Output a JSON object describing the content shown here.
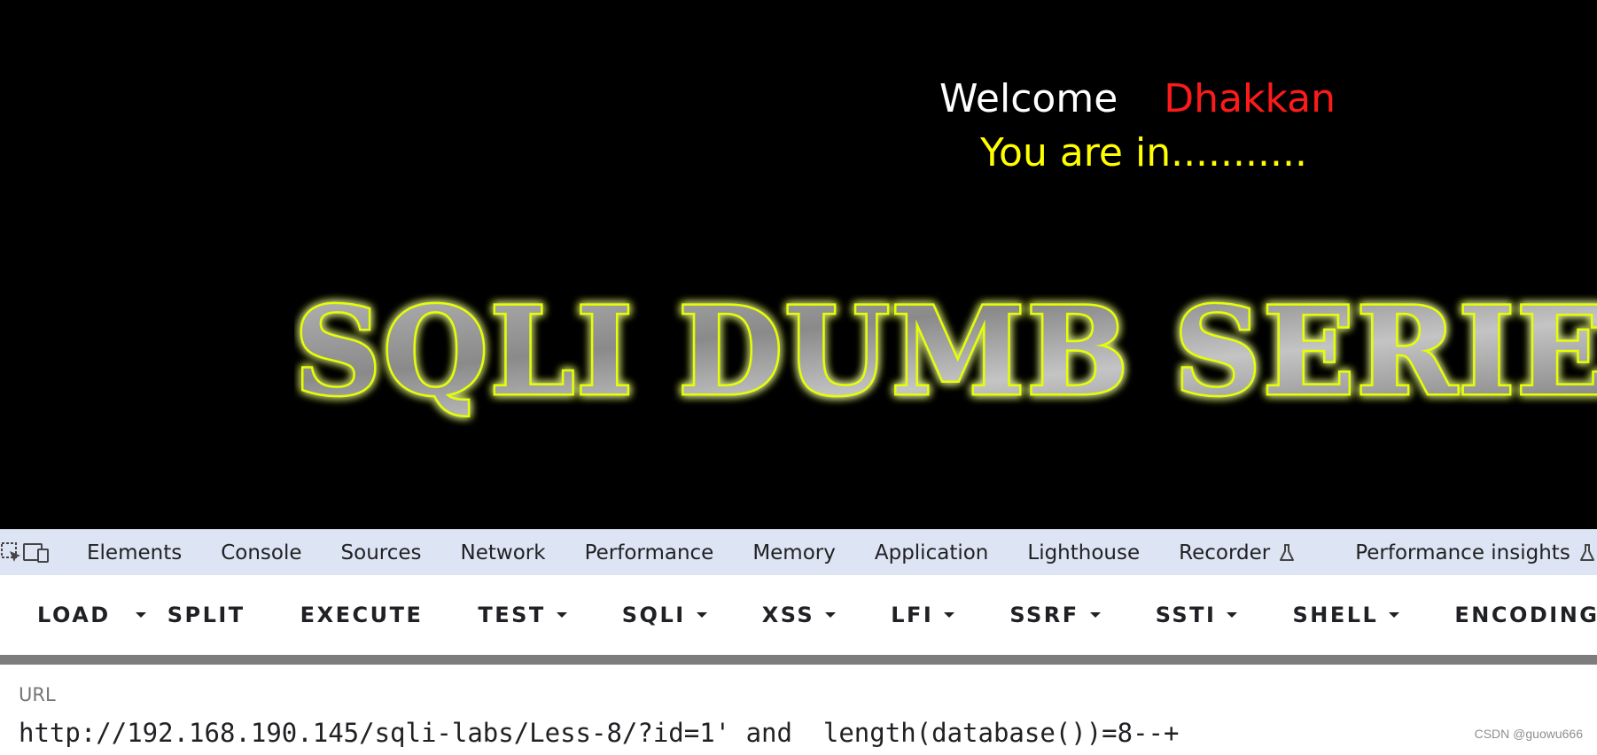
{
  "web": {
    "welcome_word": "Welcome",
    "welcome_name": "Dhakkan",
    "status": "You are in...........",
    "banner_text": "SQLI DUMB SERIES"
  },
  "devtools": {
    "tabs": [
      {
        "label": "Elements"
      },
      {
        "label": "Console"
      },
      {
        "label": "Sources"
      },
      {
        "label": "Network"
      },
      {
        "label": "Performance"
      },
      {
        "label": "Memory"
      },
      {
        "label": "Application"
      },
      {
        "label": "Lighthouse"
      },
      {
        "label": "Recorder"
      },
      {
        "label": "Performance insights"
      }
    ]
  },
  "hackbar": {
    "load": "LOAD",
    "split": "SPLIT",
    "execute": "EXECUTE",
    "test": "TEST",
    "sqli": "SQLI",
    "xss": "XSS",
    "lfi": "LFI",
    "ssrf": "SSRF",
    "ssti": "SSTI",
    "shell": "SHELL",
    "encoding": "ENCODING"
  },
  "url_panel": {
    "label": "URL",
    "value": "http://192.168.190.145/sqli-labs/Less-8/?id=1' and  length(database())=8--+"
  },
  "watermark": "CSDN @guowu666",
  "colors": {
    "welcome_name": "#ff1a1a",
    "status": "#ffff00",
    "banner_glow": "#e6ff00",
    "devtools_bg": "#dde5f4"
  }
}
